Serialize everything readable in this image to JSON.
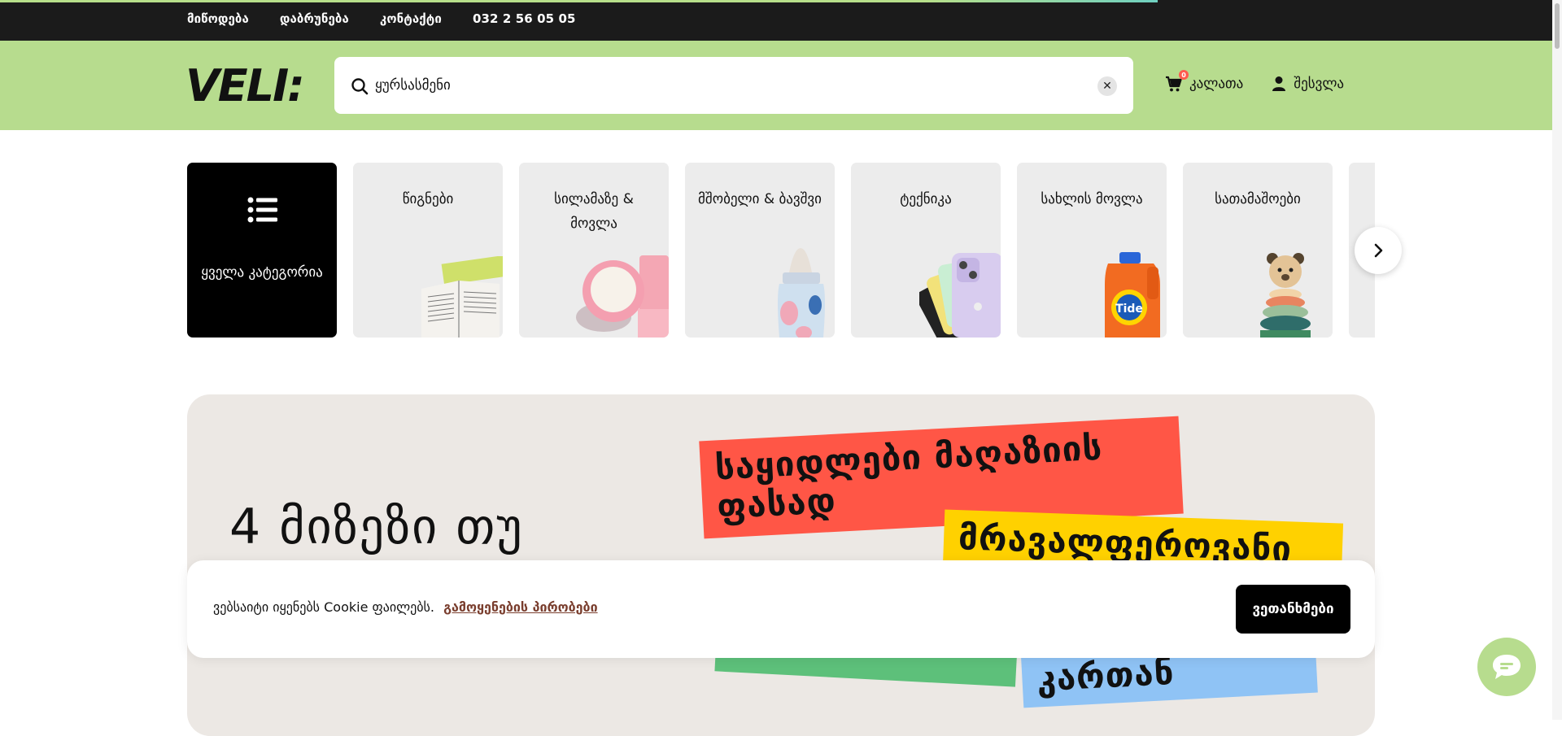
{
  "topbar": {
    "links": [
      "მიწოდება",
      "დაბრუნება",
      "კონტაქტი",
      "032 2 56 05 05"
    ]
  },
  "header": {
    "logo_text": "VELI:",
    "search": {
      "value": "ყურსასმენი",
      "placeholder": ""
    },
    "cart": {
      "label": "კალათა",
      "count": "0"
    },
    "login": {
      "label": "შესვლა"
    }
  },
  "categories": [
    {
      "label": "ყველა კატეგორია",
      "icon": "list-icon"
    },
    {
      "label": "წიგნები",
      "icon": "book-image"
    },
    {
      "label": "სილამაზე & მოვლა",
      "icon": "cream-jar-image"
    },
    {
      "label": "მშობელი & ბავშვი",
      "icon": "baby-bottle-image"
    },
    {
      "label": "ტექნიკა",
      "icon": "phone-image"
    },
    {
      "label": "სახლის მოვლა",
      "icon": "detergent-image"
    },
    {
      "label": "სათამაშოები",
      "icon": "toy-stacker-image"
    },
    {
      "label": "",
      "icon": "partial-card"
    }
  ],
  "banner": {
    "headline": "4 მიზეზი თუ",
    "stickers": [
      "საყიდლები მაღაზიის ფასად",
      "მრავალფეროვანი",
      "",
      "კართან"
    ]
  },
  "cookie": {
    "text": "ვებსაიტი იყენებს Cookie ფაილებს.",
    "link": "გამოყენების პირობები",
    "button": "ვეთანხმები"
  },
  "colors": {
    "header_bg": "#b7dc8e",
    "topbar_bg": "#1b1b1b",
    "banner_bg": "#ece8e4",
    "sticker_red": "#ff5646",
    "sticker_yellow": "#ffd100",
    "sticker_green": "#5dc07a",
    "sticker_blue": "#8fc3f5"
  }
}
